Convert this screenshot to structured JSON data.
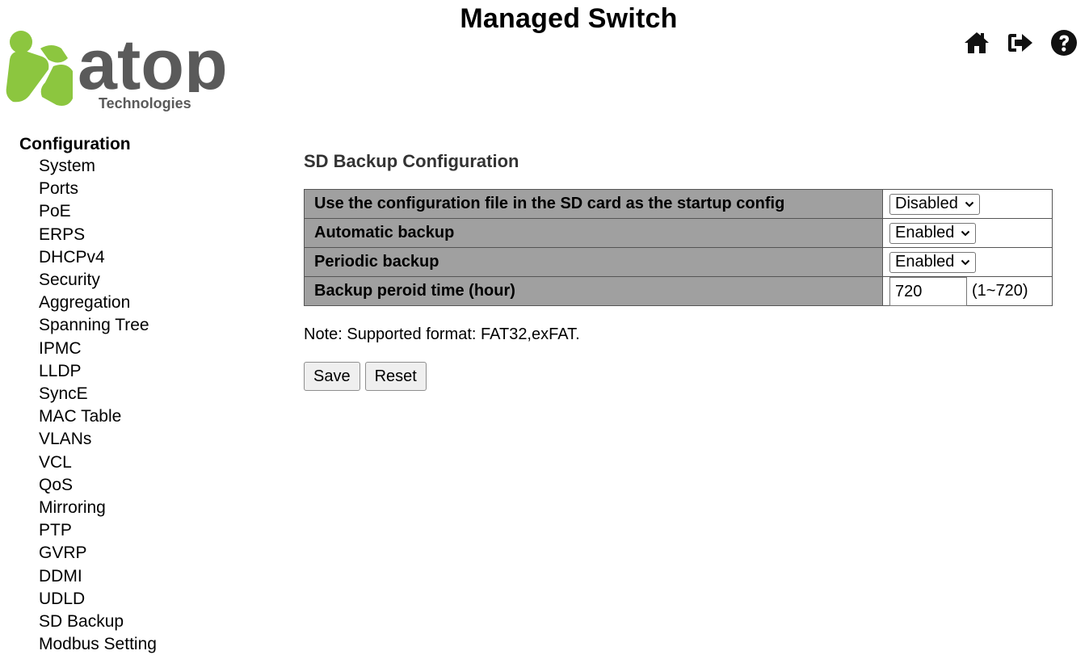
{
  "header": {
    "title": "Managed Switch",
    "logo_text": "atop",
    "logo_subtext": "Technologies",
    "icons": [
      "home-icon",
      "logout-icon",
      "help-icon"
    ]
  },
  "sidebar": {
    "heading": "Configuration",
    "items": [
      {
        "label": "System"
      },
      {
        "label": "Ports"
      },
      {
        "label": "PoE"
      },
      {
        "label": "ERPS"
      },
      {
        "label": "DHCPv4"
      },
      {
        "label": "Security"
      },
      {
        "label": "Aggregation"
      },
      {
        "label": "Spanning Tree"
      },
      {
        "label": "IPMC"
      },
      {
        "label": "LLDP"
      },
      {
        "label": "SyncE"
      },
      {
        "label": "MAC Table"
      },
      {
        "label": "VLANs"
      },
      {
        "label": "VCL"
      },
      {
        "label": "QoS"
      },
      {
        "label": "Mirroring"
      },
      {
        "label": "PTP"
      },
      {
        "label": "GVRP"
      },
      {
        "label": "DDMI"
      },
      {
        "label": "UDLD"
      },
      {
        "label": "SD Backup"
      },
      {
        "label": "Modbus Setting"
      }
    ]
  },
  "main": {
    "title": "SD Backup Configuration",
    "rows": [
      {
        "label": "Use the configuration file in the SD card as the startup config",
        "value": "Disabled"
      },
      {
        "label": "Automatic backup",
        "value": "Enabled"
      },
      {
        "label": "Periodic backup",
        "value": "Enabled"
      },
      {
        "label": "Backup peroid time (hour)",
        "value": "720",
        "range": "(1~720)"
      }
    ],
    "note": "Note: Supported format: FAT32,exFAT.",
    "save_label": "Save",
    "reset_label": "Reset"
  },
  "colors": {
    "logo_green": "#8cc63f",
    "logo_gray": "#5a5a5a",
    "table_header_bg": "#a0a0a0"
  }
}
